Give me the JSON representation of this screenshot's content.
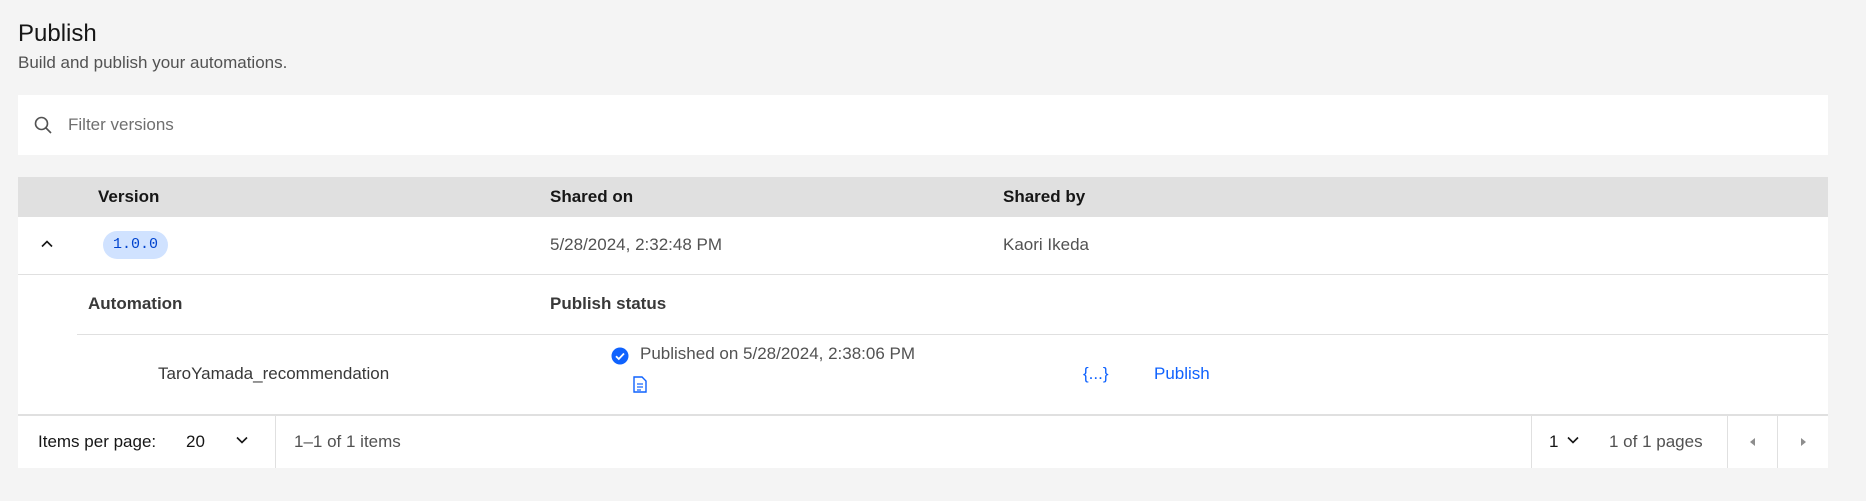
{
  "header": {
    "title": "Publish",
    "subtitle": "Build and publish your automations."
  },
  "search": {
    "placeholder": "Filter versions",
    "icon": "search-icon"
  },
  "table": {
    "columns": [
      "Version",
      "Shared on",
      "Shared by"
    ],
    "rows": [
      {
        "version": "1.0.0",
        "shared_on": "5/28/2024, 2:32:48 PM",
        "shared_by": "Kaori Ikeda",
        "expanded": true,
        "sub_columns": [
          "Automation",
          "Publish status"
        ],
        "automations": [
          {
            "name": "TaroYamada_recommendation",
            "status": "Published on 5/28/2024, 2:38:06 PM",
            "status_icon": "check-circle-icon",
            "doc_icon": "document-icon",
            "json_link": "{...}",
            "publish_label": "Publish"
          }
        ]
      }
    ]
  },
  "pagination": {
    "items_per_page_label": "Items per page:",
    "items_per_page_value": "20",
    "range_text": "1–1 of 1 items",
    "page_value": "1",
    "pages_text": "1 of 1 pages"
  },
  "colors": {
    "accent": "#0f62fe",
    "badge_bg": "#d0e2ff",
    "success": "#0f62fe"
  }
}
